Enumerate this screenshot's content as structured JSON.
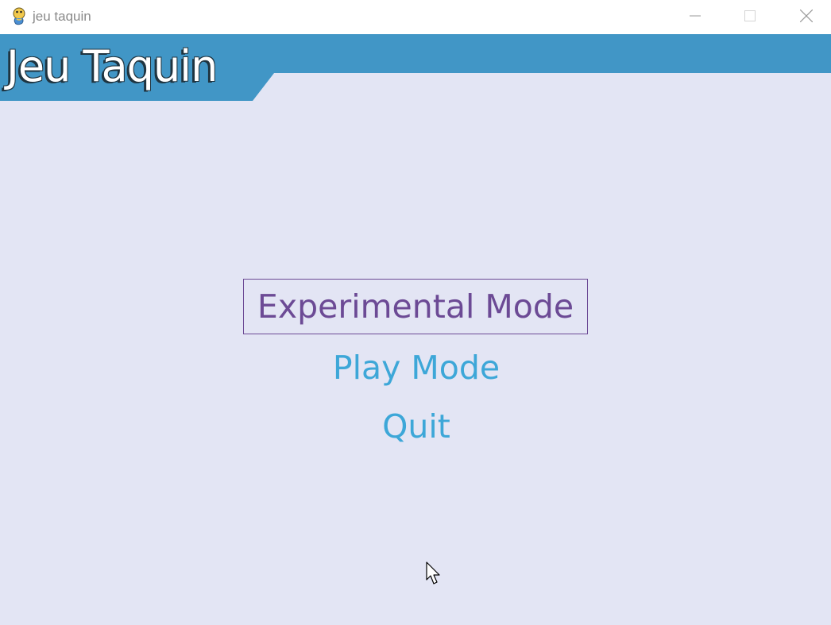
{
  "window": {
    "title": "jeu taquin",
    "app_icon": "python-snake-icon",
    "controls": [
      "minimize-icon",
      "maximize-icon",
      "close-icon"
    ]
  },
  "header": {
    "title": "Jeu Taquin"
  },
  "menu": {
    "items": [
      {
        "label": "Experimental Mode",
        "selected": true
      },
      {
        "label": "Play Mode",
        "selected": false
      },
      {
        "label": "Quit",
        "selected": false
      }
    ]
  },
  "colors": {
    "background": "#e3e5f4",
    "header": "#4196c6",
    "menu_selected": "#6c4a95",
    "menu_default": "#3da7d8"
  },
  "cursor": "arrow-pointer-icon"
}
